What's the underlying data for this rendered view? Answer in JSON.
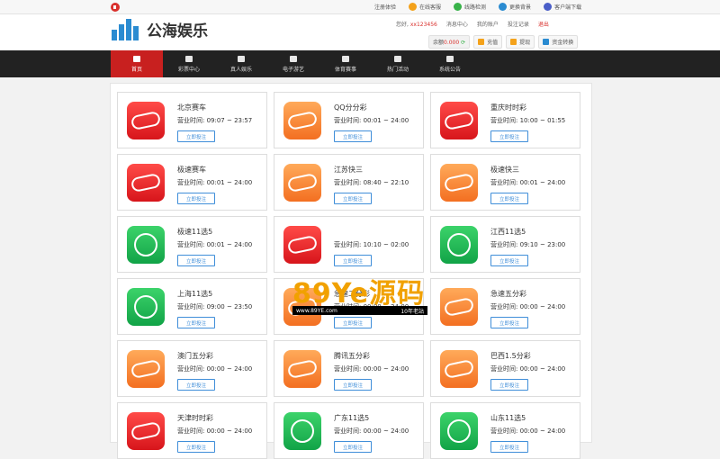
{
  "topbar": {
    "links": [
      {
        "label": "注册体验",
        "icon": "none-icon",
        "color": ""
      },
      {
        "label": "在线客服",
        "icon": "chat-icon",
        "color": "#f4a21b"
      },
      {
        "label": "线路检测",
        "icon": "phone-icon",
        "color": "#38b249"
      },
      {
        "label": "更换背景",
        "icon": "palette-icon",
        "color": "#2a8bd1"
      },
      {
        "label": "客户端下载",
        "icon": "download-icon",
        "color": "#4a5ec8"
      }
    ]
  },
  "header": {
    "logo_text": "公海娱乐",
    "greeting": "您好,",
    "username": "xx123456",
    "links": [
      "消息中心",
      "我的账户",
      "投注记录"
    ],
    "logout": "退出",
    "balance_label": "余额",
    "balance_value": "0.000",
    "buttons": [
      {
        "label": "充值",
        "color": "#f4a21b"
      },
      {
        "label": "提现",
        "color": "#f4a21b"
      },
      {
        "label": "资金转换",
        "color": "#2a8bd1"
      }
    ]
  },
  "nav": {
    "items": [
      {
        "label": "首页",
        "icon": "home-icon"
      },
      {
        "label": "彩票中心",
        "icon": "lottery-icon"
      },
      {
        "label": "真人娱乐",
        "icon": "casino-chip-icon"
      },
      {
        "label": "电子游艺",
        "icon": "slot-icon"
      },
      {
        "label": "体育赛事",
        "icon": "sports-icon"
      },
      {
        "label": "热门活动",
        "icon": "gift-icon"
      },
      {
        "label": "系统公告",
        "icon": "notice-icon"
      }
    ],
    "active_index": 0
  },
  "lotteries": [
    {
      "name": "北京赛车",
      "hours": "营业时间: 09:07 ~ 23:57",
      "color": "red",
      "button": "立即投注"
    },
    {
      "name": "QQ分分彩",
      "hours": "营业时间: 00:01 ~ 24:00",
      "color": "orange",
      "button": "立即投注"
    },
    {
      "name": "重庆时时彩",
      "hours": "营业时间: 10:00 ~ 01:55",
      "color": "red",
      "button": "立即投注"
    },
    {
      "name": "极速赛车",
      "hours": "营业时间: 00:01 ~ 24:00",
      "color": "red",
      "button": "立即投注"
    },
    {
      "name": "江苏快三",
      "hours": "营业时间: 08:40 ~ 22:10",
      "color": "orange",
      "button": "立即投注"
    },
    {
      "name": "极速快三",
      "hours": "营业时间: 00:01 ~ 24:00",
      "color": "orange",
      "button": "立即投注"
    },
    {
      "name": "极速11选5",
      "hours": "营业时间: 00:01 ~ 24:00",
      "color": "green",
      "button": "立即投注"
    },
    {
      "name": "",
      "hours": "营业时间: 10:10 ~ 02:00",
      "color": "red",
      "button": "立即投注"
    },
    {
      "name": "江西11选5",
      "hours": "营业时间: 09:10 ~ 23:00",
      "color": "green",
      "button": "立即投注"
    },
    {
      "name": "上海11选5",
      "hours": "营业时间: 09:00 ~ 23:50",
      "color": "green",
      "button": "立即投注"
    },
    {
      "name": "急速二分彩",
      "hours": "营业时间: 00:00 ~ 24:00",
      "color": "orange",
      "button": "立即投注"
    },
    {
      "name": "急速五分彩",
      "hours": "营业时间: 00:00 ~ 24:00",
      "color": "orange",
      "button": "立即投注"
    },
    {
      "name": "澳门五分彩",
      "hours": "营业时间: 00:00 ~ 24:00",
      "color": "orange",
      "button": "立即投注"
    },
    {
      "name": "腾讯五分彩",
      "hours": "营业时间: 00:00 ~ 24:00",
      "color": "orange",
      "button": "立即投注"
    },
    {
      "name": "巴西1.5分彩",
      "hours": "营业时间: 00:00 ~ 24:00",
      "color": "orange",
      "button": "立即投注"
    },
    {
      "name": "天津时时彩",
      "hours": "营业时间: 00:00 ~ 24:00",
      "color": "red",
      "button": "立即投注"
    },
    {
      "name": "广东11选5",
      "hours": "营业时间: 00:00 ~ 24:00",
      "color": "green",
      "button": "立即投注"
    },
    {
      "name": "山东11选5",
      "hours": "营业时间: 00:00 ~ 24:00",
      "color": "green",
      "button": "立即投注"
    }
  ],
  "watermark": {
    "main": "89Ye源码",
    "url": "www.89YE.com",
    "tag": "10年老站"
  }
}
